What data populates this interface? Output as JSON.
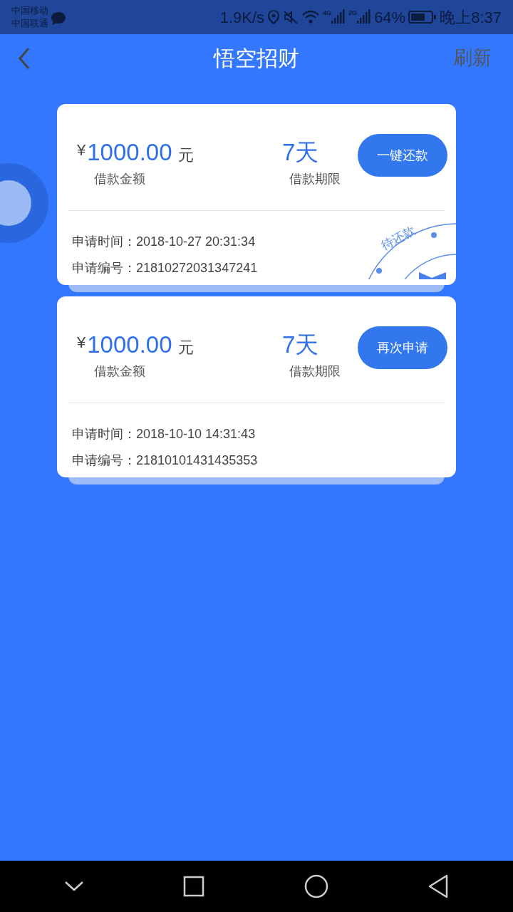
{
  "status_bar": {
    "carriers": [
      "中国移动",
      "中国联通"
    ],
    "speed": "1.9K/s",
    "net1": "4G",
    "net2": "2G",
    "battery": "64%",
    "time": "晚上8:37"
  },
  "header": {
    "title": "悟空招财",
    "action": "刷新"
  },
  "loans": [
    {
      "currency": "¥",
      "amount": "1000.00",
      "unit": "元",
      "amount_label": "借款金额",
      "term": "7天",
      "term_label": "借款期限",
      "button": "一键还款",
      "time_label": "申请时间：",
      "time": "2018-10-27 20:31:34",
      "number_label": "申请编号：",
      "number": "21810272031347241",
      "stamp": "待还款"
    },
    {
      "currency": "¥",
      "amount": "1000.00",
      "unit": "元",
      "amount_label": "借款金额",
      "term": "7天",
      "term_label": "借款期限",
      "button": "再次申请",
      "time_label": "申请时间：",
      "time": "2018-10-10 14:31:43",
      "number_label": "申请编号：",
      "number": "21810101431435353"
    }
  ]
}
